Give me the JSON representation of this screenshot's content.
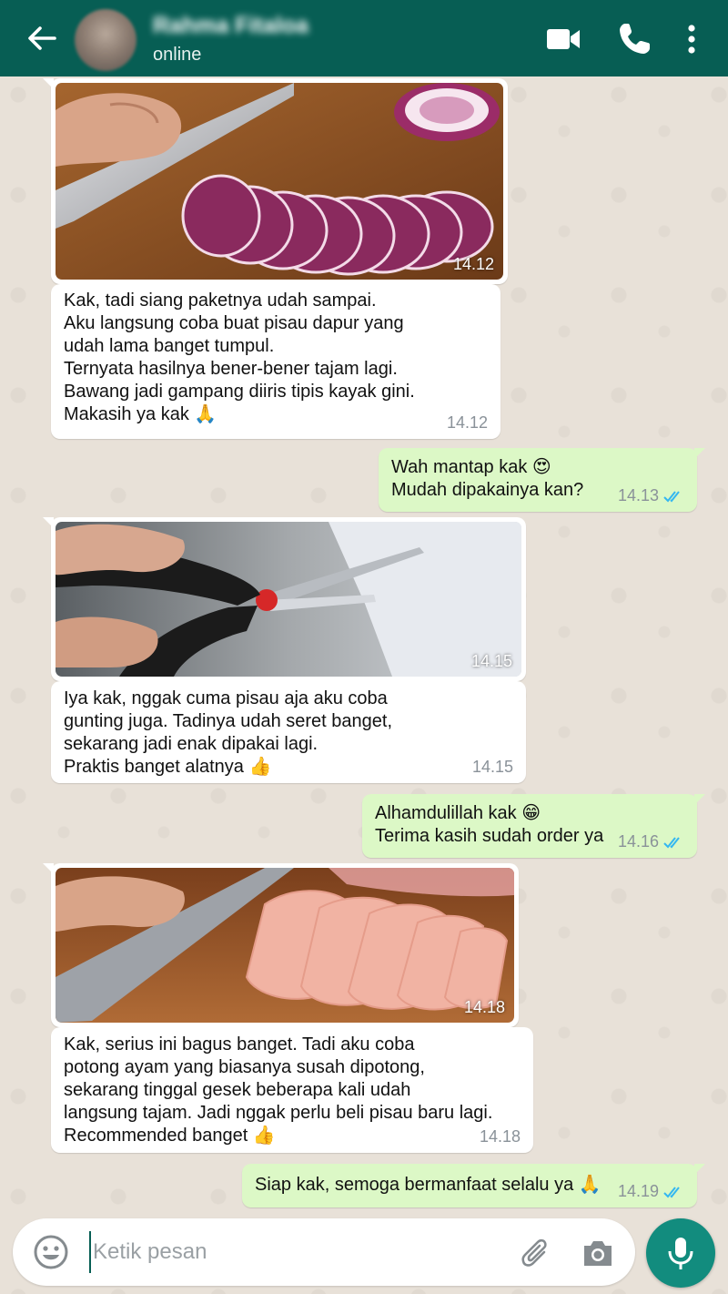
{
  "header": {
    "contact_name": "Rahma Fitaloa",
    "status": "online"
  },
  "messages": [
    {
      "type": "image",
      "direction": "incoming",
      "image": "onion-slicing-photo",
      "time": "14.12"
    },
    {
      "type": "text",
      "direction": "incoming",
      "text": "Kak, tadi siang paketnya udah sampai.\nAku langsung coba buat pisau dapur yang\nudah lama banget tumpul.\nTernyata hasilnya bener-bener tajam lagi.\nBawang jadi gampang diiris tipis kayak gini.\nMakasih ya kak 🙏",
      "time": "14.12"
    },
    {
      "type": "text",
      "direction": "outgoing",
      "text": "Wah mantap kak 😍\nMudah dipakainya kan?",
      "time": "14.13",
      "status": "read"
    },
    {
      "type": "image",
      "direction": "incoming",
      "image": "scissors-cutting-paper-photo",
      "time": "14.15"
    },
    {
      "type": "text",
      "direction": "incoming",
      "text": "Iya kak, nggak cuma pisau aja aku coba\ngunting juga. Tadinya udah seret banget,\nsekarang jadi enak dipakai lagi.\nPraktis banget alatnya 👍",
      "time": "14.15"
    },
    {
      "type": "text",
      "direction": "outgoing",
      "text": "Alhamdulillah kak 😁\nTerima kasih sudah order ya",
      "time": "14.16",
      "status": "read"
    },
    {
      "type": "image",
      "direction": "incoming",
      "image": "chicken-slicing-photo",
      "time": "14.18"
    },
    {
      "type": "text",
      "direction": "incoming",
      "text": "Kak, serius ini bagus banget. Tadi aku coba\npotong ayam yang biasanya susah dipotong,\nsekarang tinggal gesek beberapa kali udah\nlangsung tajam. Jadi nggak perlu beli pisau baru lagi.\nRecommended banget 👍",
      "time": "14.18"
    },
    {
      "type": "text",
      "direction": "outgoing",
      "text": "Siap kak, semoga bermanfaat selalu ya 🙏",
      "time": "14.19",
      "status": "read"
    }
  ],
  "input": {
    "placeholder": "Ketik pesan"
  },
  "colors": {
    "header": "#075e54",
    "outgoing_bubble": "#dcf8c6",
    "incoming_bubble": "#ffffff",
    "read_ticks": "#34b7f1",
    "mic_button": "#128c7e"
  }
}
